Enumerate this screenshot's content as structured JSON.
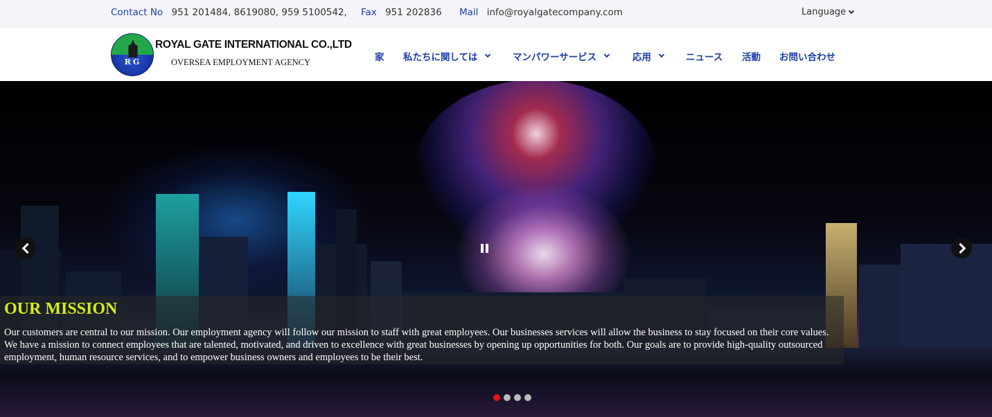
{
  "topbar": {
    "contact_label": "Contact No",
    "contact_value": "951 201484, 8619080, 959 5100542,",
    "fax_label": "Fax",
    "fax_value": "951 202836",
    "mail_label": "Mail",
    "mail_value": "info@royalgatecompany.com",
    "language_label": "Language"
  },
  "header": {
    "logo_initials": "RG",
    "brand_name": "ROYAL GATE INTERNATIONAL CO.,LTD",
    "tagline": "OVERSEA EMPLOYMENT AGENCY"
  },
  "nav": {
    "home": "家",
    "about": "私たちに関しては",
    "manpower": "マンパワーサービス",
    "apply": "応用",
    "news": "ニュース",
    "activities": "活動",
    "contact": "お問い合わせ"
  },
  "hero": {
    "title": "OUR MISSION",
    "text": "Our customers are central to our mission. Our employment agency will follow our mission to staff with great employees. Our businesses services will allow the business to stay focused on their core values. We have a mission to connect employees that are talented, motivated, and driven to excellence with great businesses by opening up opportunities for both. Our goals are to provide high-quality outsourced employment, human resource services, and to empower business owners and employees to be their best.",
    "slide_count": 4,
    "active_slide": 1
  },
  "colors": {
    "link_blue": "#1e40a8",
    "caption_title": "#d7f00a",
    "active_dot": "#e51313",
    "topbar_bg": "#f4f4f9"
  }
}
